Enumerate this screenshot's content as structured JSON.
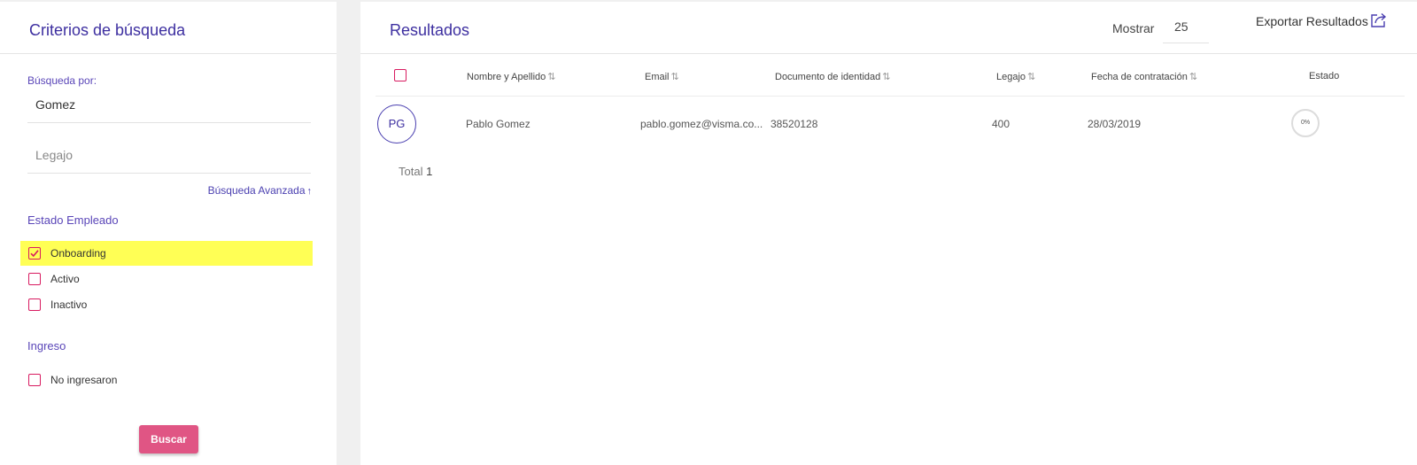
{
  "filters": {
    "title": "Criterios de búsqueda",
    "search_label": "Búsqueda por:",
    "name_value": "Gomez",
    "legajo_placeholder": "Legajo",
    "advanced_link": "Búsqueda Avanzada",
    "estado_title": "Estado Empleado",
    "estado_options": [
      {
        "label": "Onboarding",
        "checked": true
      },
      {
        "label": "Activo",
        "checked": false
      },
      {
        "label": "Inactivo",
        "checked": false
      }
    ],
    "ingreso_title": "Ingreso",
    "ingreso_options": [
      {
        "label": "No ingresaron",
        "checked": false
      }
    ],
    "search_button": "Buscar"
  },
  "results": {
    "title": "Resultados",
    "show_label": "Mostrar",
    "page_size": "25",
    "export_label": "Exportar Resultados",
    "columns": [
      "Nombre y Apellido",
      "Email",
      "Documento de identidad",
      "Legajo",
      "Fecha de contratación",
      "Estado"
    ],
    "rows": [
      {
        "initials": "PG",
        "name": "Pablo Gomez",
        "email": "pablo.gomez@visma.co...",
        "document": "38520128",
        "legajo": "400",
        "hire_date": "28/03/2019",
        "progress": "0%"
      }
    ],
    "total_label": "Total",
    "total_value": "1"
  },
  "colors": {
    "accent": "#3d2fa0",
    "checkbox": "#d81b60",
    "button": "#e05584",
    "highlight": "#ffff55"
  }
}
